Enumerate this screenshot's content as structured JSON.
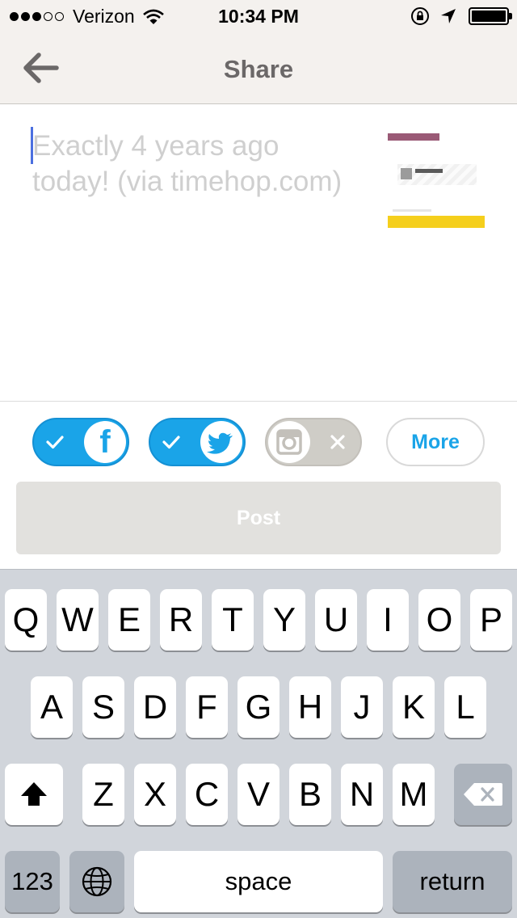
{
  "status_bar": {
    "carrier": "Verizon",
    "time": "10:34 PM"
  },
  "nav": {
    "title": "Share"
  },
  "compose": {
    "text": "Exactly 4 years ago today! (via timehop.com)"
  },
  "share_toggles": {
    "facebook": {
      "enabled": true
    },
    "twitter": {
      "enabled": true
    },
    "instagram": {
      "enabled": false
    },
    "more_label": "More"
  },
  "post_label": "Post",
  "colors": {
    "accent": "#1aa4e8",
    "nav_bg": "#f4f1ee",
    "post_disabled": "#e2e1de",
    "placeholder_text": "#cfcfcf",
    "keyboard_bg": "#d1d5db"
  },
  "keyboard": {
    "row1": [
      "Q",
      "W",
      "E",
      "R",
      "T",
      "Y",
      "U",
      "I",
      "O",
      "P"
    ],
    "row2": [
      "A",
      "S",
      "D",
      "F",
      "G",
      "H",
      "J",
      "K",
      "L"
    ],
    "row3": [
      "Z",
      "X",
      "C",
      "V",
      "B",
      "N",
      "M"
    ],
    "numbers_label": "123",
    "space_label": "space",
    "return_label": "return"
  }
}
